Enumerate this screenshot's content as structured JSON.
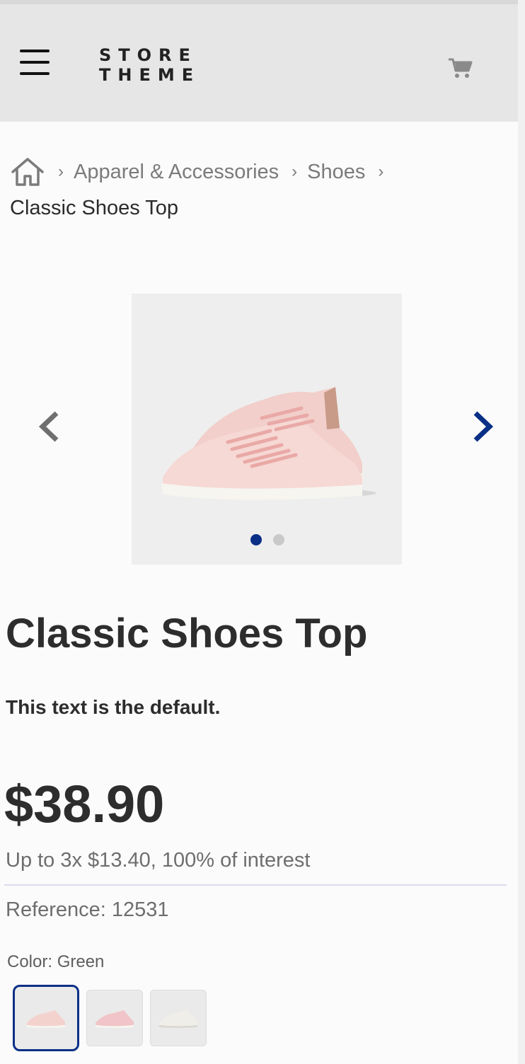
{
  "header": {
    "logo_line1": "STORE",
    "logo_line2": "THEME",
    "menu_icon": "hamburger-menu-icon",
    "cart_icon": "cart-icon"
  },
  "breadcrumb": {
    "home_icon": "home-icon",
    "separator": "›",
    "items": [
      "Apparel & Accessories",
      "Shoes"
    ],
    "current": "Classic Shoes Top"
  },
  "gallery": {
    "prev_icon": "chevron-left-icon",
    "next_icon": "chevron-right-icon",
    "slide_count": 2,
    "active_slide": 1
  },
  "product": {
    "name": "Classic Shoes Top",
    "description": "This text is the default.",
    "price": "$38.90",
    "installments": "Up to 3x $13.40, 100% of interest",
    "reference": "Reference: 12531",
    "color_label": "Color: Green",
    "swatch_count": 3,
    "selected_swatch": 1
  },
  "colors": {
    "accent": "#0a2f86",
    "header_bg": "#e6e6e6",
    "text_dark": "#2d2d2d",
    "text_muted": "#6e6e6e",
    "shoe_pink": "#f4d3cf",
    "shoe_white": "#f1f0ea"
  }
}
